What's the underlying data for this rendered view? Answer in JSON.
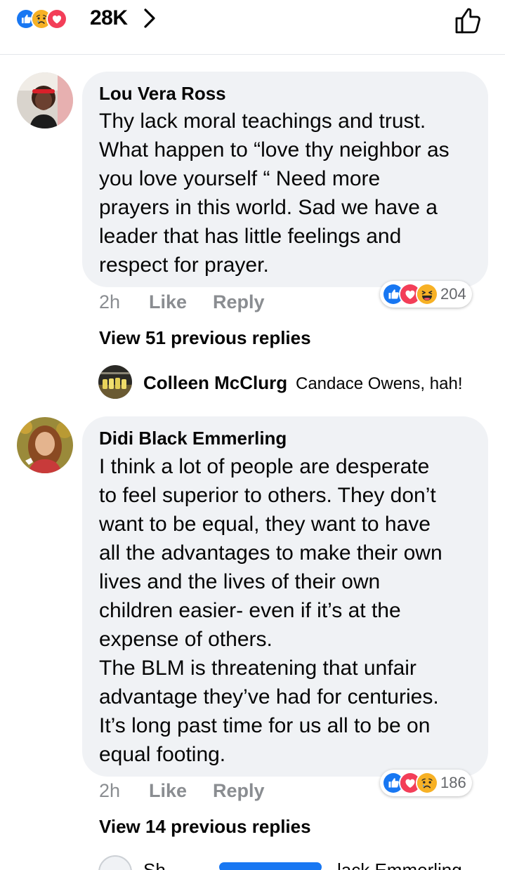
{
  "top": {
    "reactions": [
      "like-icon",
      "sad-icon",
      "love-icon"
    ],
    "count": "28K"
  },
  "comments": [
    {
      "author": "Lou Vera Ross",
      "text": "Thy lack moral teachings and trust.\nWhat happen to “love thy neighbor as\nyou love yourself “ Need more\nprayers in this world. Sad we have a\nleader that has little feelings and\nrespect for prayer.",
      "time": "2h",
      "like_label": "Like",
      "reply_label": "Reply",
      "reactions": [
        "like-icon",
        "love-icon",
        "haha-icon"
      ],
      "reaction_count": "204",
      "view_replies": "View 51 previous replies",
      "latest_reply": {
        "author": "Colleen McClurg",
        "text": "Candace Owens, hah!"
      }
    },
    {
      "author": "Didi Black Emmerling",
      "text": "I think a lot of people are desperate\nto feel superior to others. They don’t\nwant to be equal, they want to have\nall the advantages to make their own\nlives and the lives of their own\nchildren easier- even if it’s at the\nexpense of others.\nThe BLM is threatening that unfair\nadvantage they’ve had for centuries.\nIt’s long past time for us all to be on\nequal footing.",
      "time": "2h",
      "like_label": "Like",
      "reply_label": "Reply",
      "reactions": [
        "like-icon",
        "love-icon",
        "sad-icon"
      ],
      "reaction_count": "186",
      "view_replies": "View 14 previous replies",
      "latest_reply_partial": {
        "author": "Sh",
        "text": "lack Emmerling"
      }
    }
  ],
  "colors": {
    "like": "#1877f2",
    "love": "#f33e58",
    "emoji": "#f7b125",
    "bubble": "#f0f2f5",
    "muted": "#8a8d91"
  }
}
